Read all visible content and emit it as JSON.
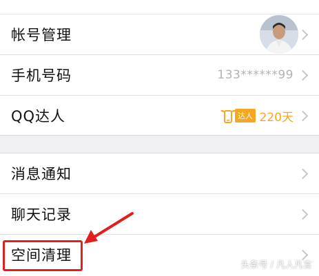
{
  "settings_group_1": {
    "items": [
      {
        "label": "帐号管理"
      },
      {
        "label": "手机号码",
        "value": "133******99"
      },
      {
        "label": "QQ达人",
        "badge": "达人",
        "value": "220天"
      }
    ]
  },
  "settings_group_2": {
    "items": [
      {
        "label": "消息通知"
      },
      {
        "label": "聊天记录"
      },
      {
        "label": "空间清理"
      }
    ]
  },
  "watermark": "头条号 / 凡人凡言",
  "colors": {
    "accent_orange": "#f5a623",
    "highlight_red": "#e02020",
    "chevron": "#c7c7cc"
  }
}
